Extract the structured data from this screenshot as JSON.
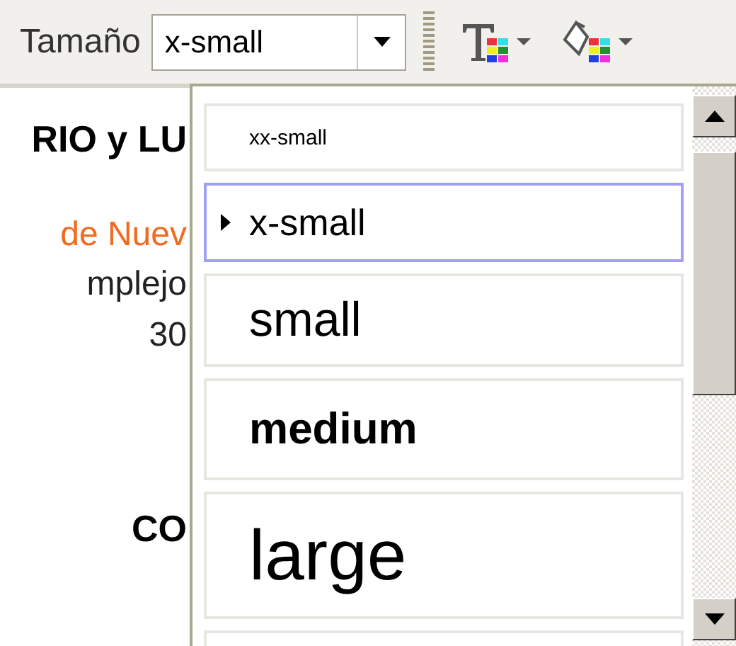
{
  "toolbar": {
    "size_label": "Tamaño",
    "size_combo": {
      "value": "x-small"
    }
  },
  "document": {
    "lines": [
      {
        "text": "RIO y LU",
        "kind": "heading"
      },
      {
        "text": "de Nuev",
        "kind": "link"
      },
      {
        "text": "mplejo",
        "kind": "body"
      },
      {
        "text": "30",
        "kind": "body"
      },
      {
        "text": "CO",
        "kind": "heading"
      }
    ]
  },
  "size_list": {
    "items": [
      {
        "label": "xx-small",
        "selected": false
      },
      {
        "label": "x-small",
        "selected": true
      },
      {
        "label": "small",
        "selected": false
      },
      {
        "label": "medium",
        "selected": false
      },
      {
        "label": "large",
        "selected": false
      }
    ]
  }
}
